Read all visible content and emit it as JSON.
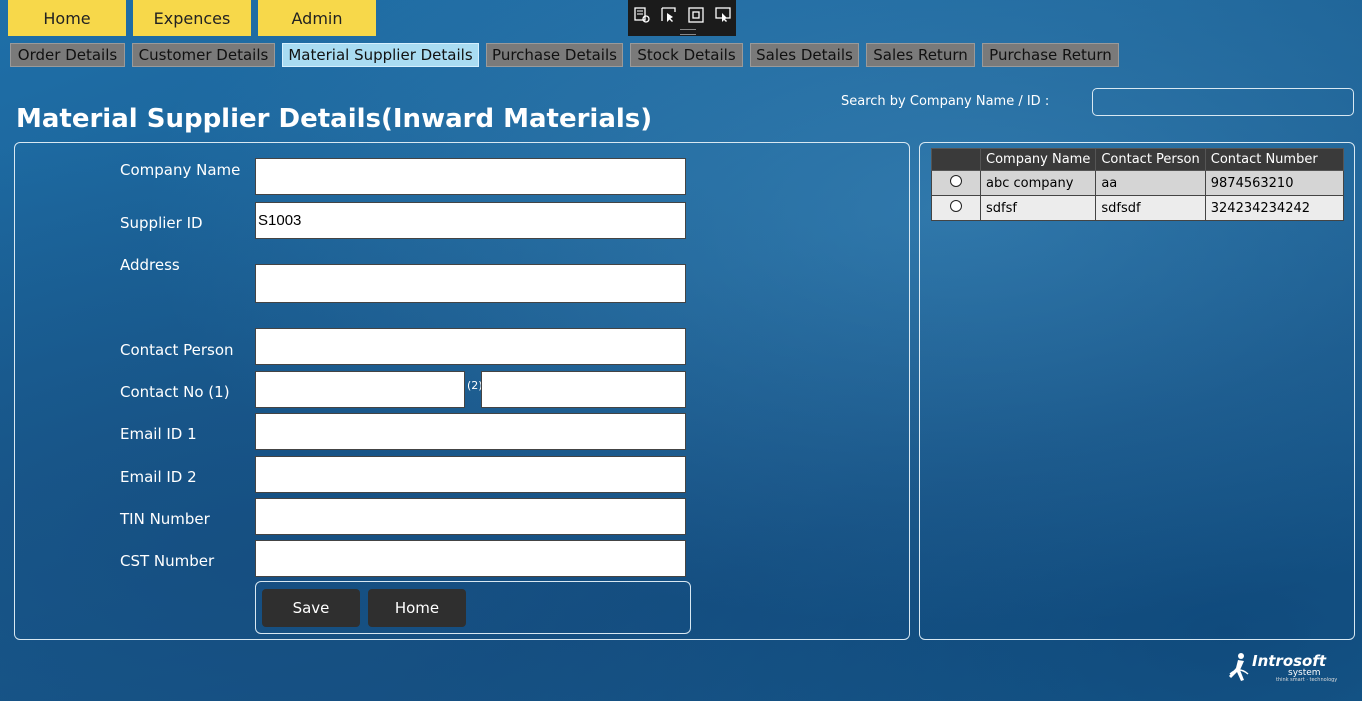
{
  "top_nav": {
    "home": "Home",
    "expences": "Expences",
    "admin": "Admin"
  },
  "tabs": [
    {
      "label": "Order Details"
    },
    {
      "label": "Customer Details"
    },
    {
      "label": "Material Supplier Details",
      "active": true
    },
    {
      "label": "Purchase Details"
    },
    {
      "label": "Stock Details"
    },
    {
      "label": "Sales Details"
    },
    {
      "label": "Sales Return"
    },
    {
      "label": "Purchase Return"
    }
  ],
  "toolbar_icons": [
    "select-element-icon",
    "pointer-icon",
    "frame-icon",
    "screen-cursor-icon"
  ],
  "page_title": "Material Supplier Details(Inward Materials)",
  "search": {
    "label": "Search by Company Name / ID :",
    "value": ""
  },
  "form": {
    "company_name": {
      "label": "Company Name",
      "value": ""
    },
    "supplier_id": {
      "label": "Supplier ID",
      "value": "S1003"
    },
    "address": {
      "label": "Address",
      "value": ""
    },
    "contact_person": {
      "label": "Contact Person",
      "value": ""
    },
    "contact_no": {
      "label": "Contact No (1)",
      "value1": "",
      "label2": "(2)",
      "value2": ""
    },
    "email1": {
      "label": "Email ID 1",
      "value": ""
    },
    "email2": {
      "label": "Email ID 2",
      "value": ""
    },
    "tin": {
      "label": "TIN Number",
      "value": ""
    },
    "cst": {
      "label": "CST Number",
      "value": ""
    },
    "save_label": "Save",
    "home_label": "Home"
  },
  "grid": {
    "columns": [
      "",
      "Company Name",
      "Contact Person",
      "Contact Number"
    ],
    "rows": [
      {
        "company": "abc company",
        "contact_person": "aa",
        "contact_number": "9874563210"
      },
      {
        "company": "sdfsf",
        "contact_person": "sdfsdf",
        "contact_number": "324234234242"
      }
    ]
  },
  "logo": {
    "name": "Introsoft",
    "sub": "system",
    "tag": "think smart · technology"
  }
}
